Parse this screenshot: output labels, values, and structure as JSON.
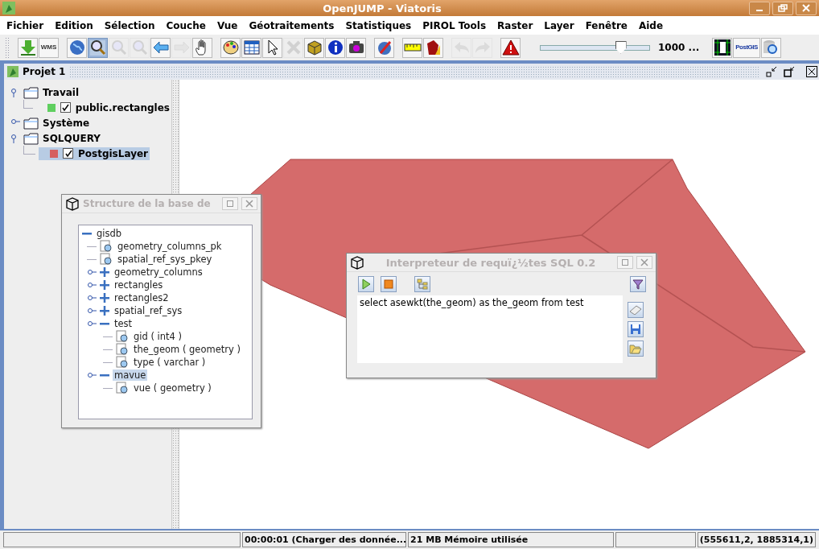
{
  "window": {
    "title": "OpenJUMP - Viatoris"
  },
  "menu": [
    "Fichier",
    "Edition",
    "Sélection",
    "Couche",
    "Vue",
    "Géotraitements",
    "Statistiques",
    "PIROL Tools",
    "Raster",
    "Layer",
    "Fenêtre",
    "Aide"
  ],
  "toolbar": {
    "groups": [
      [
        {
          "kind": "download",
          "disabled": false,
          "selected": false
        },
        {
          "kind": "wms",
          "label": "WMS",
          "disabled": false,
          "selected": false
        }
      ],
      [
        {
          "kind": "globe",
          "disabled": false,
          "selected": false
        },
        {
          "kind": "zoom",
          "disabled": false,
          "selected": true
        },
        {
          "kind": "zoom-box",
          "disabled": true,
          "selected": false
        },
        {
          "kind": "zoom-box",
          "disabled": true,
          "selected": false
        },
        {
          "kind": "arrow-left",
          "disabled": false,
          "selected": false
        },
        {
          "kind": "arrow-right",
          "disabled": true,
          "selected": false
        },
        {
          "kind": "hand",
          "disabled": false,
          "selected": false
        }
      ],
      [
        {
          "kind": "palette",
          "disabled": false,
          "selected": false
        },
        {
          "kind": "grid",
          "disabled": false,
          "selected": false
        },
        {
          "kind": "pointer",
          "disabled": false,
          "selected": false
        },
        {
          "kind": "delete",
          "disabled": true,
          "selected": false
        },
        {
          "kind": "box",
          "disabled": false,
          "selected": false
        },
        {
          "kind": "info",
          "disabled": false,
          "selected": false
        },
        {
          "kind": "camera",
          "disabled": false,
          "selected": false
        }
      ],
      [
        {
          "kind": "pencil",
          "disabled": false,
          "selected": false
        }
      ],
      [
        {
          "kind": "ruler",
          "disabled": false,
          "selected": false
        },
        {
          "kind": "shape",
          "disabled": false,
          "selected": false
        }
      ],
      [
        {
          "kind": "undo",
          "disabled": true,
          "selected": false
        },
        {
          "kind": "redo",
          "disabled": true,
          "selected": false
        }
      ],
      [
        {
          "kind": "warning",
          "disabled": false,
          "selected": false
        }
      ]
    ],
    "scale": {
      "level": 0.73,
      "reading": "1000 ..."
    },
    "end_group": [
      {
        "kind": "help",
        "disabled": false,
        "selected": false
      },
      {
        "kind": "postgis",
        "label": "PostGIS",
        "disabled": false,
        "selected": false
      },
      {
        "kind": "db-search",
        "disabled": false,
        "selected": false
      }
    ]
  },
  "project": {
    "title": "Projet 1"
  },
  "layer_tree": [
    {
      "name": "Travail",
      "expanded": true,
      "children": [
        {
          "name": "public.rectangles",
          "color": "#5fcf5f",
          "checked": true,
          "selected": false
        }
      ]
    },
    {
      "name": "Système",
      "expanded": false
    },
    {
      "name": "SQLQUERY",
      "expanded": true,
      "children": [
        {
          "name": "PostgisLayer",
          "color": "#d66060",
          "checked": true,
          "selected": true
        }
      ]
    }
  ],
  "structure_dialog": {
    "title": "Structure de la base de",
    "tree": {
      "name": "gisdb",
      "expanded": true,
      "children": [
        {
          "name": "geometry_columns_pk",
          "kind": "index",
          "selected": false
        },
        {
          "name": "spatial_ref_sys_pkey",
          "kind": "index",
          "selected": false
        },
        {
          "name": "geometry_columns",
          "kind": "table",
          "expanded": false,
          "selected": false
        },
        {
          "name": "rectangles",
          "kind": "table",
          "expanded": false,
          "selected": false
        },
        {
          "name": "rectangles2",
          "kind": "table",
          "expanded": false,
          "selected": false
        },
        {
          "name": "spatial_ref_sys",
          "kind": "table",
          "expanded": false,
          "selected": false
        },
        {
          "name": "test",
          "kind": "table",
          "expanded": true,
          "selected": false,
          "children": [
            {
              "name": "gid ( int4 )",
              "kind": "column"
            },
            {
              "name": "the_geom ( geometry )",
              "kind": "column"
            },
            {
              "name": "type ( varchar )",
              "kind": "column"
            }
          ]
        },
        {
          "name": "mavue",
          "kind": "table",
          "expanded": true,
          "selected": true,
          "children": [
            {
              "name": "vue ( geometry )",
              "kind": "column"
            }
          ]
        }
      ]
    }
  },
  "sql_dialog": {
    "title": "Interpreteur de requï¿½tes SQL 0.2",
    "query": "select asewkt(the_geom) as the_geom from test"
  },
  "status_bar": {
    "time": "00:00:01 (Charger des donnée...",
    "memory": "21 MB Mémoire utilisée",
    "coordinates": "(555611,2, 1885314,1)"
  }
}
